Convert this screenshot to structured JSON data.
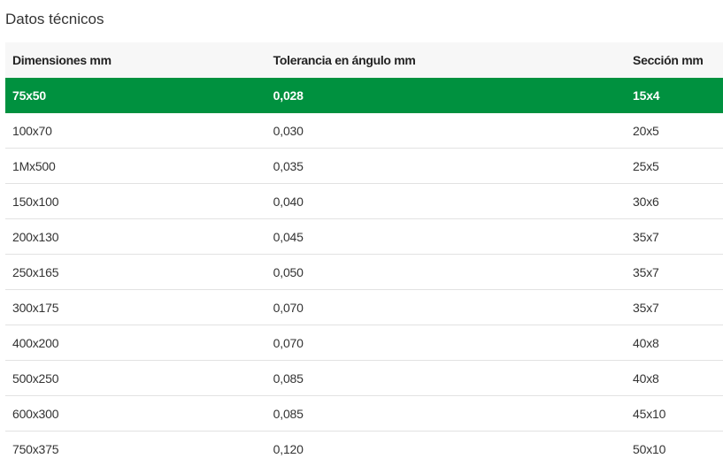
{
  "section": {
    "title": "Datos técnicos"
  },
  "table": {
    "headers": [
      "Dimensiones mm",
      "Tolerancia en ángulo mm",
      "Sección mm"
    ],
    "rows": [
      {
        "dimension": "75x50",
        "tolerance": "0,028",
        "section": "15x4",
        "highlighted": true
      },
      {
        "dimension": "100x70",
        "tolerance": "0,030",
        "section": "20x5"
      },
      {
        "dimension": "1Mx500",
        "tolerance": "0,035",
        "section": "25x5"
      },
      {
        "dimension": "150x100",
        "tolerance": "0,040",
        "section": "30x6"
      },
      {
        "dimension": "200x130",
        "tolerance": "0,045",
        "section": "35x7"
      },
      {
        "dimension": "250x165",
        "tolerance": "0,050",
        "section": "35x7"
      },
      {
        "dimension": "300x175",
        "tolerance": "0,070",
        "section": "35x7"
      },
      {
        "dimension": "400x200",
        "tolerance": "0,070",
        "section": "40x8"
      },
      {
        "dimension": "500x250",
        "tolerance": "0,085",
        "section": "40x8"
      },
      {
        "dimension": "600x300",
        "tolerance": "0,085",
        "section": "45x10"
      },
      {
        "dimension": "750x375",
        "tolerance": "0,120",
        "section": "50x10"
      }
    ]
  },
  "colors": {
    "highlight": "#00913f",
    "header_bg": "#f7f7f7",
    "row_border": "#e2e2e2"
  }
}
